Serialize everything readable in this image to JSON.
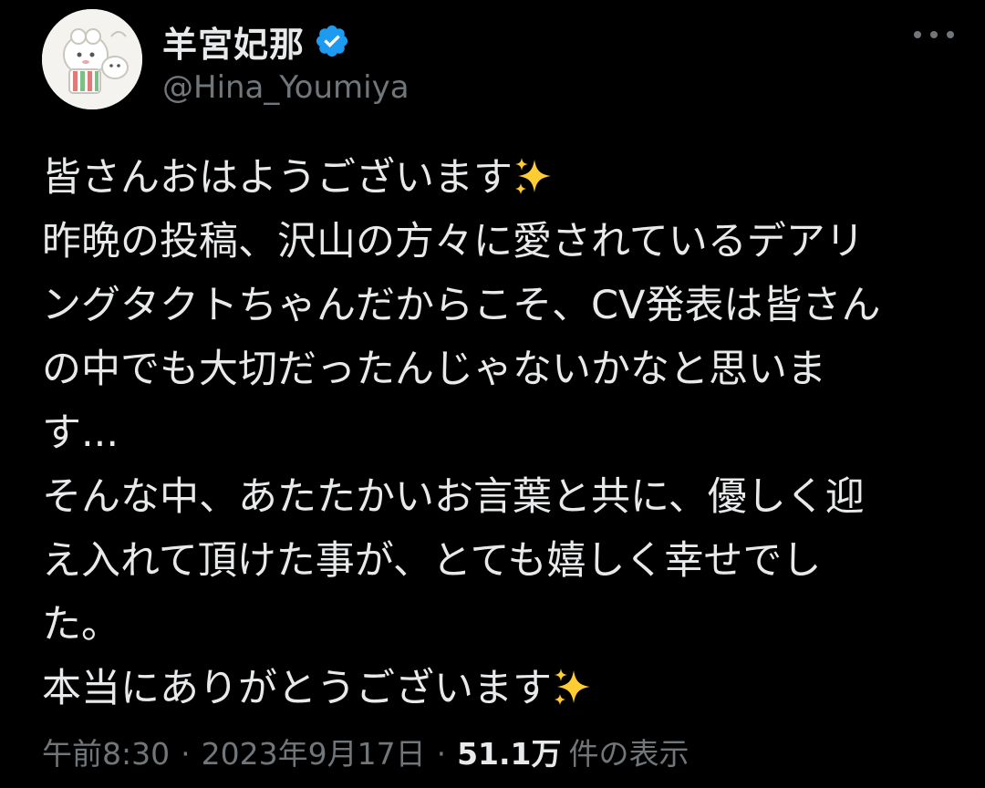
{
  "author": {
    "display_name": "羊宮妃那",
    "handle": "@Hina_Youmiya",
    "verified_color": "#1d9bf0",
    "avatar_icon": "avatar-sheep-illustration"
  },
  "more_icon": "more-horizontal-icon",
  "tweet": {
    "lines": [
      "皆さんおはようございます",
      "昨晩の投稿、沢山の方々に愛されているデアリ",
      "ングタクトちゃんだからこそ、CV発表は皆さん",
      "の中でも大切だったんじゃないかなと思いま",
      "す...",
      "そんな中、あたたかいお言葉と共に、優しく迎",
      "え入れて頂けた事が、とても嬉しく幸せでし",
      "た。",
      "本当にありがとうございます"
    ],
    "emoji": "sparkles-emoji"
  },
  "meta": {
    "time": "午前8:30",
    "separator": "·",
    "date": "2023年9月17日",
    "views_count": "51.1万",
    "views_label": "件の表示"
  },
  "colors": {
    "background": "#000000",
    "text": "#e7e9ea",
    "secondary": "#71767b",
    "sparkle": "#ffcc33"
  }
}
